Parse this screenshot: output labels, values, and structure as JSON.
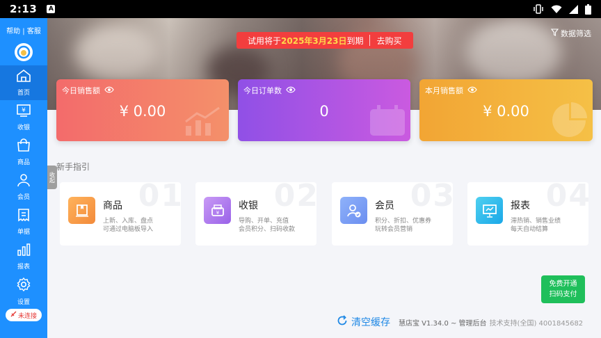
{
  "status_bar": {
    "time": "2:13",
    "notice_glyph": "A"
  },
  "sidebar": {
    "help_text": "帮助 | 客服",
    "items": [
      {
        "label": "首页",
        "icon": "home-icon",
        "active": true
      },
      {
        "label": "收银",
        "icon": "cashier-icon"
      },
      {
        "label": "商品",
        "icon": "bag-icon"
      },
      {
        "label": "会员",
        "icon": "member-icon"
      },
      {
        "label": "单据",
        "icon": "receipt-icon"
      },
      {
        "label": "报表",
        "icon": "bar-chart-icon"
      },
      {
        "label": "设置",
        "icon": "gear-icon"
      }
    ],
    "connection_status": "未连接",
    "collapse_label": "收起"
  },
  "banner": {
    "trial_prefix": "试用将于",
    "trial_date": "2025年3月23日",
    "trial_suffix": "到期",
    "buy_label": "去购买",
    "filter_label": "数据筛选"
  },
  "stats": [
    {
      "title": "今日销售额",
      "value": "¥ 0.00"
    },
    {
      "title": "今日订单数",
      "value": "0"
    },
    {
      "title": "本月销售额",
      "value": "¥ 0.00"
    }
  ],
  "guide": {
    "title": "新手指引",
    "items": [
      {
        "num": "01",
        "name": "商品",
        "desc1": "上新、入库、盘点",
        "desc2": "可通过电脑板导入"
      },
      {
        "num": "02",
        "name": "收银",
        "desc1": "导购、开单、充值",
        "desc2": "会员积分、扫码收款"
      },
      {
        "num": "03",
        "name": "会员",
        "desc1": "积分、折扣、优惠券",
        "desc2": "玩转会员营销"
      },
      {
        "num": "04",
        "name": "报表",
        "desc1": "滞热销、销售业绩",
        "desc2": "每天自动结算"
      }
    ]
  },
  "free_button": {
    "line1": "免费开通",
    "line2": "扫码支付"
  },
  "footer": {
    "clear_cache": "清空缓存",
    "version": "慧店宝 V1.34.0 ~ 管理后台",
    "support": "技术支持(全国) 4001845682"
  },
  "colors": {
    "sidebar": "#1e90ff",
    "trial_banner": "#f23e3e",
    "free_button": "#1fbf5b"
  }
}
